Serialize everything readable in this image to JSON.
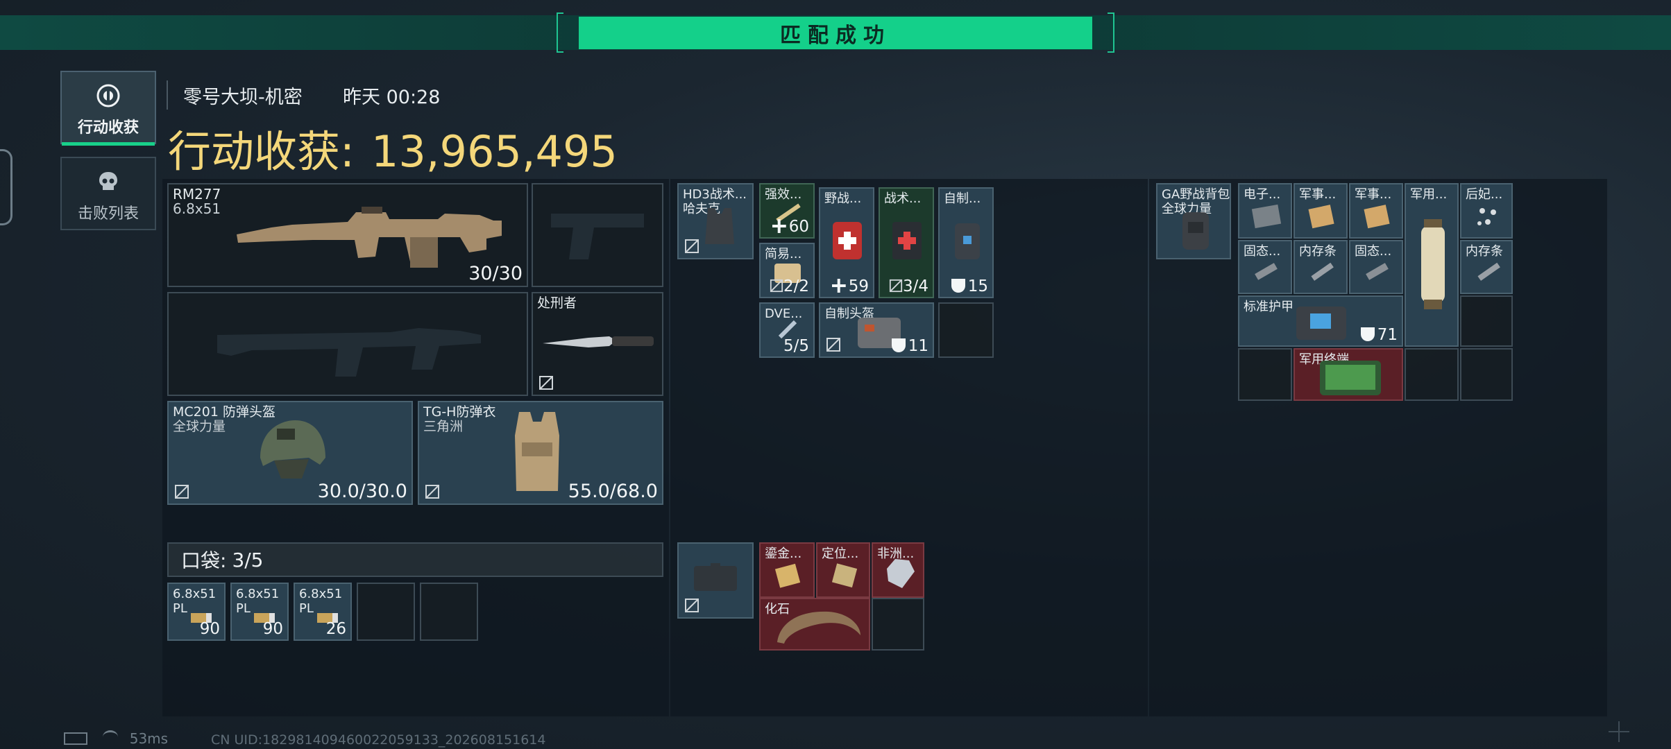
{
  "banner": {
    "title": "匹配成功"
  },
  "tabs": [
    {
      "label": "行动收获",
      "icon": "loot-icon",
      "active": true
    },
    {
      "label": "击败列表",
      "icon": "skull-icon",
      "active": false
    }
  ],
  "header": {
    "map": "零号大坝-机密",
    "time": "昨天 00:28",
    "earnings_label": "行动收获:",
    "earnings_value": "13,965,495"
  },
  "loadout": {
    "primary": {
      "name": "RM277",
      "ammo": "6.8x51",
      "count": "30/30"
    },
    "melee": {
      "name": "处刑者"
    },
    "helmet": {
      "name": "MC201 防弹头盔",
      "maker": "全球力量",
      "durability": "30.0/30.0"
    },
    "armor": {
      "name": "TG-H防弹衣",
      "maker": "三角洲",
      "durability": "55.0/68.0"
    },
    "pocket": {
      "label": "口袋:",
      "value": "3/5"
    },
    "pocket_items": [
      {
        "name": "6.8x51",
        "sub": "PL",
        "count": "90"
      },
      {
        "name": "6.8x51",
        "sub": "PL",
        "count": "90"
      },
      {
        "name": "6.8x51",
        "sub": "PL",
        "count": "26"
      }
    ]
  },
  "rig": {
    "vest": {
      "name": "HD3战术...",
      "maker": "哈夫克"
    },
    "items": [
      {
        "name": "强效...",
        "count": "60"
      },
      {
        "name": "野战...",
        "count": "59"
      },
      {
        "name": "战术...",
        "count": "3/4"
      },
      {
        "name": "自制...",
        "count": "15"
      },
      {
        "name": "简易...",
        "count": "2/2"
      },
      {
        "name": "DVE...",
        "count": "5/5"
      },
      {
        "name": "自制头盔",
        "count": "11"
      }
    ],
    "case_items": [
      {
        "name": "鎏金..."
      },
      {
        "name": "定位..."
      },
      {
        "name": "非洲..."
      },
      {
        "name": "化石"
      }
    ]
  },
  "backpack": {
    "bag": {
      "name": "GA野战背包",
      "maker": "全球力量"
    },
    "items": [
      {
        "name": "电子..."
      },
      {
        "name": "军事..."
      },
      {
        "name": "军事..."
      },
      {
        "name": "军用..."
      },
      {
        "name": "后妃..."
      },
      {
        "name": "固态..."
      },
      {
        "name": "内存条"
      },
      {
        "name": "固态..."
      },
      {
        "name": "内存条"
      },
      {
        "name": "标准护甲",
        "count": "71"
      },
      {
        "name": "军用终端"
      }
    ]
  },
  "footer": {
    "ping": "53ms",
    "uid": "CN UID:182981409460022059133_202608151614"
  },
  "colors": {
    "accent": "#14d08a",
    "gold": "#f4d77a",
    "red_slot": "#5a1f26"
  }
}
